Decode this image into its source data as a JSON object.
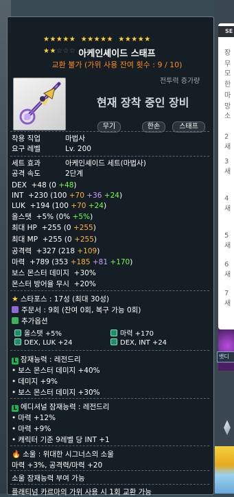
{
  "side": {
    "header": "SE",
    "lines": [
      "장",
      "무",
      "모",
      "한",
      "마",
      "망",
      "소"
    ],
    "numbers": [
      "2새",
      "3새",
      "4새",
      "5새",
      "6새",
      "7새"
    ],
    "tab": "뱃디"
  },
  "item": {
    "stars_row1_count": 15,
    "stars_row2_count": 2,
    "name": "아케인셰이드 스태프",
    "trade_info": "교환 불가 (가위 사용 잔여 횟수 : 9 / 10)",
    "cp_label": "전투력 증가량",
    "equipped_text": "현재 장착 중인 장비",
    "tags": [
      "무기",
      "한손",
      "스태프"
    ]
  },
  "basic": {
    "job_label": "착용 직업",
    "job_value": "마법사",
    "level_label": "요구 레벨",
    "level_value": "Lv. 200",
    "set_label": "세트 효과",
    "set_value": "아케인셰이드 세트(마법사)",
    "speed_label": "공격 속도",
    "speed_value": "2단계"
  },
  "stats": {
    "dex": {
      "label": "DEX",
      "total": "+48",
      "base": "0",
      "a": "+48"
    },
    "int": {
      "label": "INT",
      "total": "+230",
      "base": "100",
      "a": "+70",
      "b": "+36",
      "c": "+24"
    },
    "luk": {
      "label": "LUK",
      "total": "+194",
      "base": "100",
      "a": "+70",
      "c": "+24"
    },
    "all": {
      "label": "올스탯",
      "total": "+5%",
      "base": "0%",
      "a": "+5%"
    },
    "hp": {
      "label": "최대 HP",
      "total": "+255",
      "base": "0",
      "a": "+255"
    },
    "mp": {
      "label": "최대 MP",
      "total": "+255",
      "base": "0",
      "a": "+255"
    },
    "atk": {
      "label": "공격력",
      "total": "+327",
      "base": "218",
      "a": "+109"
    },
    "mag": {
      "label": "마력",
      "total": "+789",
      "base": "353",
      "a": "+185",
      "b": "+81",
      "c": "+170"
    },
    "boss": {
      "label": "보스 몬스터 데미지",
      "value": "+30%"
    },
    "ignore": {
      "label": "몬스터 방어율 무시",
      "value": "+20%"
    }
  },
  "enhance": {
    "starforce": "스타포스 : 17성 (최대 30성)",
    "scroll": "주문서 : 9회 (잔여 0회, 복구 가능 0회)",
    "add_title": "추가옵션",
    "add_opts": [
      {
        "text": "올스탯 +5%"
      },
      {
        "text": "마력 +170"
      },
      {
        "text": "DEX, LUK +24"
      },
      {
        "text": "DEX, INT +24"
      }
    ]
  },
  "potential": {
    "title": "잠재능력 : 레전드리",
    "lines": [
      "보스 몬스터 데미지 +40%",
      "데미지 +9%",
      "보스 몬스터 데미지 +30%"
    ],
    "add_title": "에디셔널 잠재능력 : 레전드리",
    "add_lines": [
      "마력 +12%",
      "마력 +9%",
      "캐릭터 기준 9레벨 당 INT +1"
    ]
  },
  "soul": {
    "title": "소울 : 위대한 시그너스의 소울",
    "line": "마력 +3%, 공격력/마력 +20",
    "note": "소울 잠재능력 부여 가능"
  },
  "footer": "플래티넘 카르마의 가위 사용 시 1회 교환 가능",
  "colors": {
    "star": "#ffd52b",
    "green": "#6cff4a",
    "orange": "#ffb43a",
    "purple": "#c8a2ff",
    "trade": "#ff8c1a"
  }
}
